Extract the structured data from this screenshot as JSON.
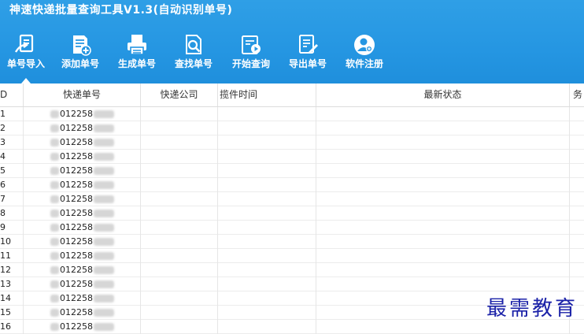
{
  "window": {
    "title": "神速快递批量查询工具V1.3(自动识别单号)"
  },
  "toolbar": [
    {
      "label": "单号导入",
      "icon": "import-doc-icon",
      "active": true
    },
    {
      "label": "添加单号",
      "icon": "add-doc-icon"
    },
    {
      "label": "生成单号",
      "icon": "printer-icon"
    },
    {
      "label": "查找单号",
      "icon": "search-doc-icon"
    },
    {
      "label": "开始查询",
      "icon": "play-doc-icon"
    },
    {
      "label": "导出单号",
      "icon": "export-doc-icon"
    },
    {
      "label": "软件注册",
      "icon": "user-register-icon"
    }
  ],
  "table": {
    "columns": [
      "D",
      "快递单号",
      "快递公司",
      "揽件时间",
      "最新状态",
      "务"
    ],
    "rows": [
      {
        "id": "1",
        "tracking": "012258"
      },
      {
        "id": "2",
        "tracking": "012258"
      },
      {
        "id": "3",
        "tracking": "012258"
      },
      {
        "id": "4",
        "tracking": "012258"
      },
      {
        "id": "5",
        "tracking": "012258"
      },
      {
        "id": "6",
        "tracking": "012258"
      },
      {
        "id": "7",
        "tracking": "012258"
      },
      {
        "id": "8",
        "tracking": "012258"
      },
      {
        "id": "9",
        "tracking": "012258"
      },
      {
        "id": "10",
        "tracking": "012258"
      },
      {
        "id": "11",
        "tracking": "012258"
      },
      {
        "id": "12",
        "tracking": "012258"
      },
      {
        "id": "13",
        "tracking": "012258"
      },
      {
        "id": "14",
        "tracking": "012258"
      },
      {
        "id": "15",
        "tracking": "012258"
      },
      {
        "id": "16",
        "tracking": "012258"
      }
    ]
  },
  "watermark": "最需教育"
}
